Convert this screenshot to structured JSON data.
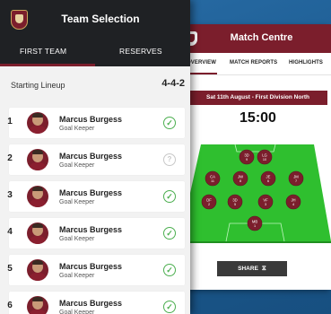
{
  "match_centre": {
    "title": "Match Centre",
    "tabs": [
      "OVERVIEW",
      "MATCH REPORTS",
      "HIGHLIGHTS"
    ],
    "date": "Sat 11th August - First Division North",
    "time": "15:00",
    "share_label": "SHARE",
    "pitch_players": [
      {
        "pos": "3D",
        "num": "9"
      },
      {
        "pos": "LG",
        "num": "10"
      },
      {
        "pos": "CA",
        "num": "11"
      },
      {
        "pos": "JW",
        "num": "8"
      },
      {
        "pos": "JE",
        "num": "6"
      },
      {
        "pos": "JM",
        "num": "7"
      },
      {
        "pos": "DF",
        "num": "2"
      },
      {
        "pos": "3D",
        "num": "5"
      },
      {
        "pos": "VF",
        "num": "3"
      },
      {
        "pos": "JH",
        "num": "4"
      },
      {
        "pos": "MB",
        "num": "1"
      }
    ],
    "colors": {
      "brand": "#7b1e2c",
      "pitch": "#2fbf2f"
    }
  },
  "team_selection": {
    "title": "Team Selection",
    "tabs": {
      "first_team": "FIRST TEAM",
      "reserves": "RESERVES"
    },
    "lineup_label": "Starting Lineup",
    "formation": "4-4-2",
    "players": [
      {
        "number": "1",
        "name": "Marcus Burgess",
        "position": "Goal Keeper",
        "status": "confirmed"
      },
      {
        "number": "2",
        "name": "Marcus Burgess",
        "position": "Goal Keeper",
        "status": "pending"
      },
      {
        "number": "3",
        "name": "Marcus Burgess",
        "position": "Goal Keeper",
        "status": "confirmed"
      },
      {
        "number": "4",
        "name": "Marcus Burgess",
        "position": "Goal Keeper",
        "status": "confirmed"
      },
      {
        "number": "5",
        "name": "Marcus Burgess",
        "position": "Goal Keeper",
        "status": "confirmed"
      },
      {
        "number": "6",
        "name": "Marcus Burgess",
        "position": "Goal Keeper",
        "status": "confirmed"
      }
    ],
    "icons": {
      "confirmed": "check-circle-icon",
      "pending": "question-circle-icon"
    },
    "colors": {
      "header": "#1f2124",
      "accent": "#7b1e2c",
      "check": "#4caf50"
    }
  }
}
